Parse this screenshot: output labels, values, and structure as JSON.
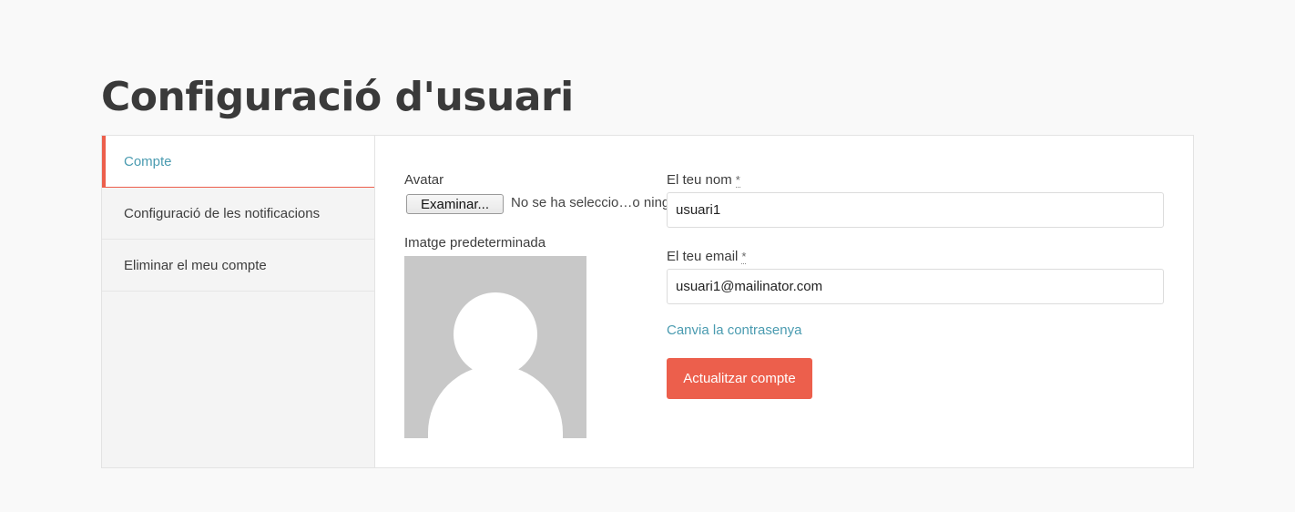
{
  "page": {
    "title": "Configuració d'usuari"
  },
  "sidebar": {
    "items": [
      {
        "label": "Compte",
        "active": true
      },
      {
        "label": "Configuració de les notificacions",
        "active": false
      },
      {
        "label": "Eliminar el meu compte",
        "active": false
      }
    ]
  },
  "form": {
    "avatar_label": "Avatar",
    "file_button_label": "Examinar...",
    "file_status": "No se ha seleccio…o ning",
    "default_image_label": "Imatge predeterminada",
    "name_label": "El teu nom",
    "name_value": "usuari1",
    "email_label": "El teu email",
    "email_value": "usuari1@mailinator.com",
    "required_marker": "*",
    "change_password_link": "Canvia la contrasenya",
    "submit_label": "Actualitzar compte"
  },
  "colors": {
    "accent": "#ec5f4c",
    "link": "#4a9bb0",
    "avatar_bg": "#c8c8c8"
  },
  "icons": {
    "avatar": "default-user-silhouette-icon"
  }
}
